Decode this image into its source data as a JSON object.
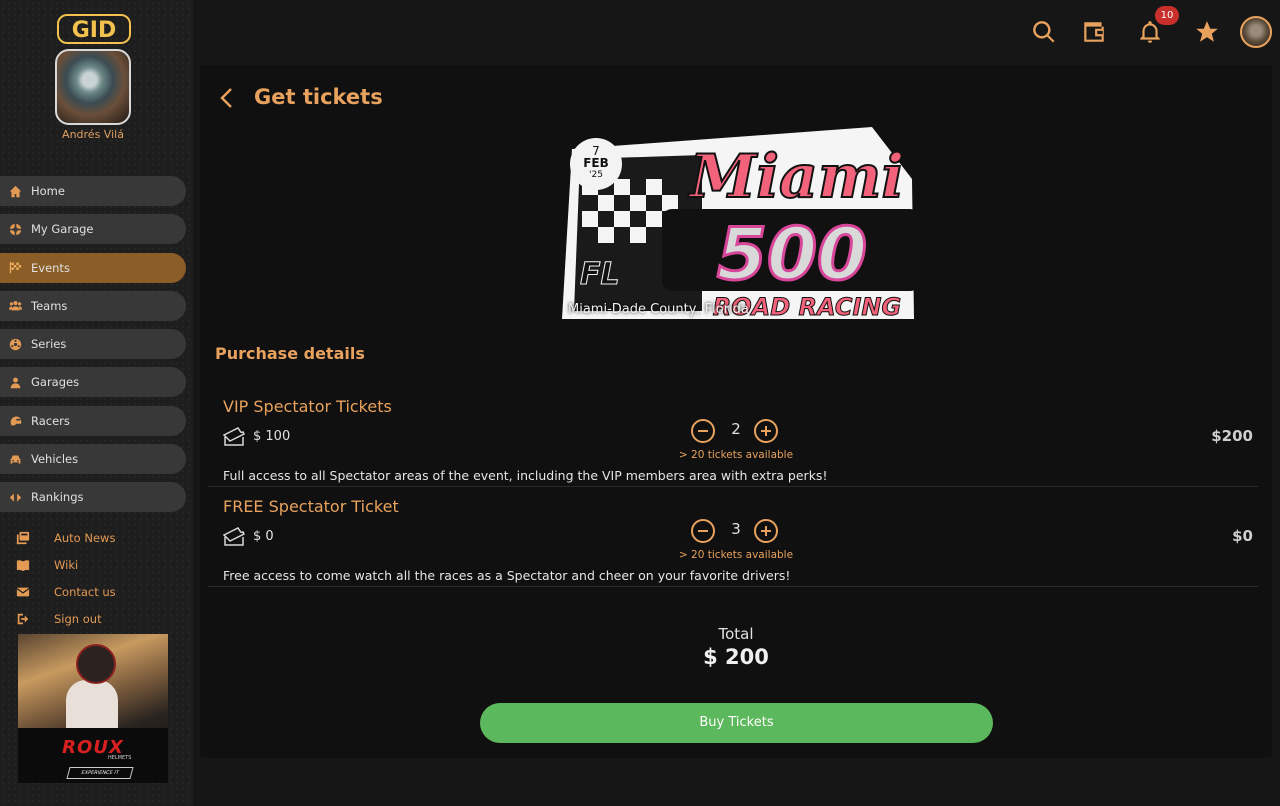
{
  "brand": {
    "logo_text": "GID"
  },
  "user": {
    "name": "Andrés Vilá"
  },
  "nav": {
    "items": [
      {
        "label": "Home",
        "icon": "home-icon"
      },
      {
        "label": "My Garage",
        "icon": "wheel-icon"
      },
      {
        "label": "Events",
        "icon": "checkered-flag-icon",
        "active": true
      },
      {
        "label": "Teams",
        "icon": "group-icon"
      },
      {
        "label": "Series",
        "icon": "tire-icon"
      },
      {
        "label": "Garages",
        "icon": "person-icon"
      },
      {
        "label": "Racers",
        "icon": "helmet-icon"
      },
      {
        "label": "Vehicles",
        "icon": "car-icon"
      },
      {
        "label": "Rankings",
        "icon": "ranking-icon"
      }
    ]
  },
  "links": [
    {
      "label": "Auto News",
      "icon": "news-icon"
    },
    {
      "label": "Wiki",
      "icon": "book-icon"
    },
    {
      "label": "Contact us",
      "icon": "mail-icon"
    },
    {
      "label": "Sign out",
      "icon": "sign-out-icon"
    }
  ],
  "ad": {
    "brand": "ROUX",
    "sub": "HELMETS",
    "cta": "EXPERIENCE IT"
  },
  "topbar": {
    "notification_count": "10"
  },
  "page": {
    "title": "Get tickets"
  },
  "event": {
    "day": "7",
    "month": "FEB",
    "year": "'25",
    "location": "Miami-Dade County, Florida",
    "logo_line1": "Miami",
    "logo_line2": "500",
    "logo_line3": "ROAD RACING",
    "logo_badge": "FL"
  },
  "purchase": {
    "section_title": "Purchase details",
    "tickets": [
      {
        "name": "VIP Spectator Tickets",
        "price": "$ 100",
        "quantity": "2",
        "availability": "> 20 tickets available",
        "subtotal": "$200",
        "description": "Full access to all Spectator areas of the event, including the VIP members area with extra perks!"
      },
      {
        "name": "FREE Spectator Ticket",
        "price": "$ 0",
        "quantity": "3",
        "availability": "> 20 tickets available",
        "subtotal": "$0",
        "description": "Free access to come watch all the races as a Spectator and cheer on your favorite drivers!"
      }
    ],
    "total_label": "Total",
    "total_value": "$ 200",
    "buy_label": "Buy Tickets"
  },
  "colors": {
    "accent": "#e8a25e",
    "active_nav": "#8a5e26",
    "buy": "#5cb85c",
    "badge": "#c9302c"
  }
}
